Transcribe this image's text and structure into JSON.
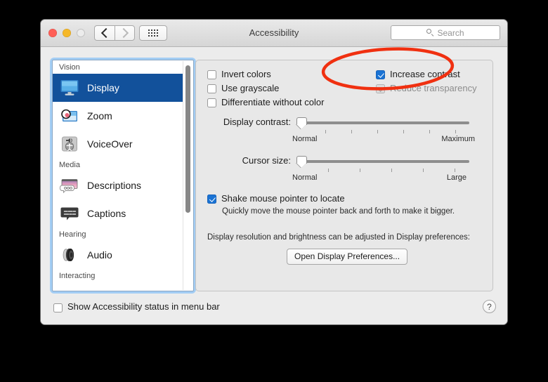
{
  "window": {
    "title": "Accessibility",
    "traffic_lights": [
      "close",
      "minimize",
      "zoom"
    ],
    "nav_back": "back-chevron",
    "nav_forward": "forward-chevron",
    "show_all": "show-all-grid",
    "search": {
      "placeholder": "Search",
      "value": ""
    }
  },
  "sidebar": {
    "sections": [
      {
        "label": "Vision",
        "items": [
          {
            "label": "Display",
            "icon": "display-monitor-icon",
            "selected": true
          },
          {
            "label": "Zoom",
            "icon": "zoom-magnifier-icon",
            "selected": false
          },
          {
            "label": "VoiceOver",
            "icon": "voiceover-icon",
            "selected": false
          }
        ]
      },
      {
        "label": "Media",
        "items": [
          {
            "label": "Descriptions",
            "icon": "descriptions-icon",
            "selected": false
          },
          {
            "label": "Captions",
            "icon": "captions-icon",
            "selected": false
          }
        ]
      },
      {
        "label": "Hearing",
        "items": [
          {
            "label": "Audio",
            "icon": "audio-speaker-icon",
            "selected": false
          }
        ]
      },
      {
        "label": "Interacting",
        "items": []
      }
    ]
  },
  "panel": {
    "checkboxes": [
      {
        "label": "Invert colors",
        "checked": false,
        "disabled": false
      },
      {
        "label": "Use grayscale",
        "checked": false,
        "disabled": false
      },
      {
        "label": "Differentiate without color",
        "checked": false,
        "disabled": false
      },
      {
        "label": "Increase contrast",
        "checked": true,
        "disabled": false
      },
      {
        "label": "Reduce transparency",
        "checked": true,
        "disabled": true
      }
    ],
    "sliders": [
      {
        "label": "Display contrast:",
        "value": 0,
        "min_label": "Normal",
        "max_label": "Maximum",
        "ticks": 6
      },
      {
        "label": "Cursor size:",
        "value": 0,
        "min_label": "Normal",
        "max_label": "Large",
        "ticks": 5
      }
    ],
    "shake_pointer": {
      "label": "Shake mouse pointer to locate",
      "checked": true,
      "description": "Quickly move the mouse pointer back and forth to make it bigger."
    },
    "display_note": "Display resolution and brightness can be adjusted in Display preferences:",
    "open_display_button": "Open Display Preferences..."
  },
  "footer": {
    "status_checkbox": {
      "label": "Show Accessibility status in menu bar",
      "checked": false
    },
    "help_label": "?"
  },
  "annotation": {
    "shape": "red-ellipse-highlight",
    "color": "#f03010",
    "targets": [
      "Increase contrast",
      "Reduce transparency"
    ]
  }
}
